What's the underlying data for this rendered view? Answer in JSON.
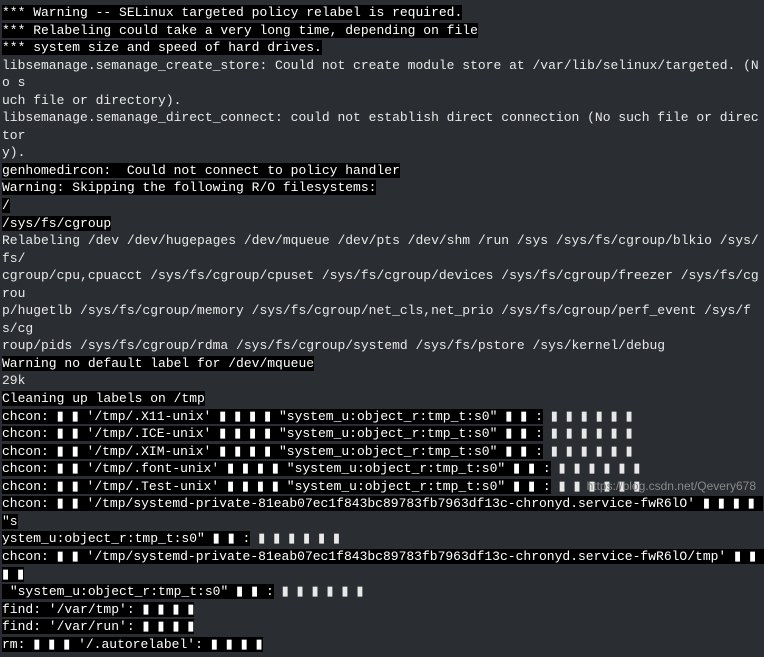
{
  "lines": [
    {
      "seg": [
        {
          "t": "*** Warning -- SELinux targeted policy relabel is required.",
          "h": true
        }
      ]
    },
    {
      "seg": [
        {
          "t": "*** Relabeling could take a very long time, depending on file",
          "h": true
        }
      ]
    },
    {
      "seg": [
        {
          "t": "*** system size and speed of hard drives.",
          "h": true
        }
      ]
    },
    {
      "seg": [
        {
          "t": "libsemanage.semanage_create_store: Could not create module store at /var/lib/selinux/targeted. (No s",
          "h": false
        }
      ]
    },
    {
      "seg": [
        {
          "t": "uch file or directory).",
          "h": false
        }
      ]
    },
    {
      "seg": [
        {
          "t": "libsemanage.semanage_direct_connect: could not establish direct connection (No such file or director",
          "h": false
        }
      ]
    },
    {
      "seg": [
        {
          "t": "y).",
          "h": false
        }
      ]
    },
    {
      "seg": [
        {
          "t": "genhomedircon:  Could not connect to policy handler",
          "h": true
        }
      ]
    },
    {
      "seg": [
        {
          "t": "Warning: Skipping the following R/O filesystems:",
          "h": true
        }
      ]
    },
    {
      "seg": [
        {
          "t": "/",
          "h": true
        }
      ]
    },
    {
      "seg": [
        {
          "t": "/sys/fs/cgroup",
          "h": true
        }
      ]
    },
    {
      "seg": [
        {
          "t": "Relabeling /dev /dev/hugepages /dev/mqueue /dev/pts /dev/shm /run /sys /sys/fs/cgroup/blkio /sys/fs/",
          "h": false
        }
      ]
    },
    {
      "seg": [
        {
          "t": "cgroup/cpu,cpuacct /sys/fs/cgroup/cpuset /sys/fs/cgroup/devices /sys/fs/cgroup/freezer /sys/fs/cgrou",
          "h": false
        }
      ]
    },
    {
      "seg": [
        {
          "t": "p/hugetlb /sys/fs/cgroup/memory /sys/fs/cgroup/net_cls,net_prio /sys/fs/cgroup/perf_event /sys/fs/cg",
          "h": false
        }
      ]
    },
    {
      "seg": [
        {
          "t": "roup/pids /sys/fs/cgroup/rdma /sys/fs/cgroup/systemd /sys/fs/pstore /sys/kernel/debug",
          "h": false
        }
      ]
    },
    {
      "seg": [
        {
          "t": "Warning no default label for /dev/mqueue",
          "h": true
        }
      ]
    },
    {
      "seg": [
        {
          "t": "29k",
          "h": false
        }
      ]
    },
    {
      "seg": [
        {
          "t": "Cleaning up labels on /tmp",
          "h": true
        }
      ]
    },
    {
      "seg": [
        {
          "t": "chcon: ▮ ▮ '/tmp/.X11-unix' ▮ ▮ ▮ ▮ \"system_u:object_r:tmp_t:s0\" ▮ ▮ :",
          "h": true
        },
        {
          "t": " ▮ ▮ ▮ ▮ ▮ ▮",
          "h": false
        }
      ]
    },
    {
      "seg": [
        {
          "t": "chcon: ▮ ▮ '/tmp/.ICE-unix' ▮ ▮ ▮ ▮ \"system_u:object_r:tmp_t:s0\" ▮ ▮ :",
          "h": true
        },
        {
          "t": " ▮ ▮ ▮ ▮ ▮ ▮",
          "h": false
        }
      ]
    },
    {
      "seg": [
        {
          "t": "chcon: ▮ ▮ '/tmp/.XIM-unix' ▮ ▮ ▮ ▮ \"system_u:object_r:tmp_t:s0\" ▮ ▮ :",
          "h": true
        },
        {
          "t": " ▮ ▮ ▮ ▮ ▮ ▮",
          "h": false
        }
      ]
    },
    {
      "seg": [
        {
          "t": "chcon: ▮ ▮ '/tmp/.font-unix' ▮ ▮ ▮ ▮ \"system_u:object_r:tmp_t:s0\" ▮ ▮ :",
          "h": true
        },
        {
          "t": " ▮ ▮ ▮ ▮ ▮ ▮",
          "h": false
        }
      ]
    },
    {
      "seg": [
        {
          "t": "chcon: ▮ ▮ '/tmp/.Test-unix' ▮ ▮ ▮ ▮ \"system_u:object_r:tmp_t:s0\" ▮ ▮ :",
          "h": true
        },
        {
          "t": " ▮ ▮ ▮ ▮ ▮ ▮",
          "h": false
        }
      ]
    },
    {
      "seg": [
        {
          "t": "chcon: ▮ ▮ '/tmp/systemd-private-81eab07ec1f843bc89783fb7963df13c-chronyd.service-fwR6lO' ▮ ▮ ▮ ▮ \"s",
          "h": true
        }
      ]
    },
    {
      "seg": [
        {
          "t": "ystem_u:object_r:tmp_t:s0\" ▮ ▮ :",
          "h": true
        },
        {
          "t": " ▮ ▮ ▮ ▮ ▮ ▮",
          "h": false
        }
      ]
    },
    {
      "seg": [
        {
          "t": "chcon: ▮ ▮ '/tmp/systemd-private-81eab07ec1f843bc89783fb7963df13c-chronyd.service-fwR6lO/tmp' ▮ ▮ ▮ ▮",
          "h": true
        }
      ]
    },
    {
      "seg": [
        {
          "t": " \"system_u:object_r:tmp_t:s0\" ▮ ▮ :",
          "h": true
        },
        {
          "t": " ▮ ▮ ▮ ▮ ▮ ▮",
          "h": false
        }
      ]
    },
    {
      "seg": [
        {
          "t": "find: '/var/tmp': ▮ ▮ ▮ ▮",
          "h": true
        }
      ]
    },
    {
      "seg": [
        {
          "t": "find: '/var/run': ▮ ▮ ▮ ▮",
          "h": true
        }
      ]
    },
    {
      "seg": [
        {
          "t": "rm: ▮ ▮ ▮ '/.autorelabel': ▮ ▮ ▮ ▮",
          "h": true
        }
      ]
    }
  ],
  "watermark": "https://blog.csdn.net/Qevery678"
}
